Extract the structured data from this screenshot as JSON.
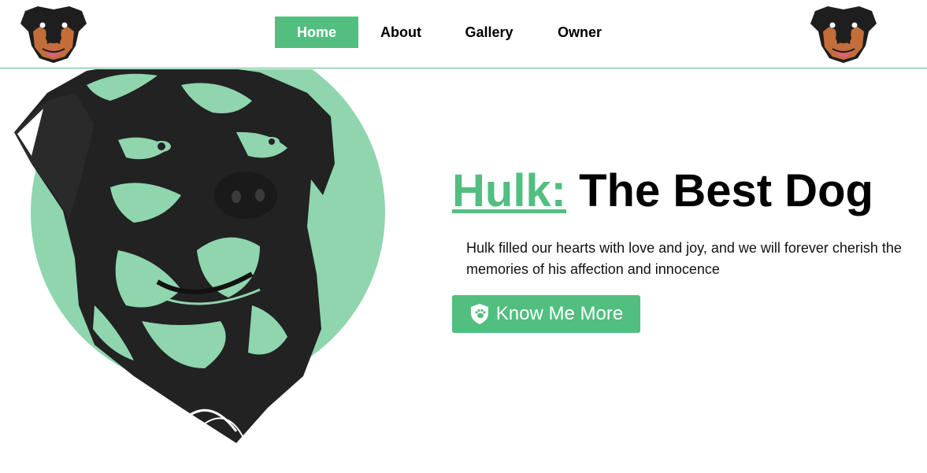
{
  "nav": {
    "items": [
      {
        "label": "Home",
        "active": true
      },
      {
        "label": "About",
        "active": false
      },
      {
        "label": "Gallery",
        "active": false
      },
      {
        "label": "Owner",
        "active": false
      }
    ]
  },
  "hero": {
    "title_accent": "Hulk:",
    "title_rest": "The Best Dog",
    "description": "Hulk filled our hearts with love and joy, and we will forever cherish the memories of his affection and innocence",
    "button_label": "Know Me More",
    "button_icon": "shield-paw-icon"
  },
  "colors": {
    "accent": "#52be80",
    "circle": "#8fd5ae",
    "dark": "#222222"
  }
}
